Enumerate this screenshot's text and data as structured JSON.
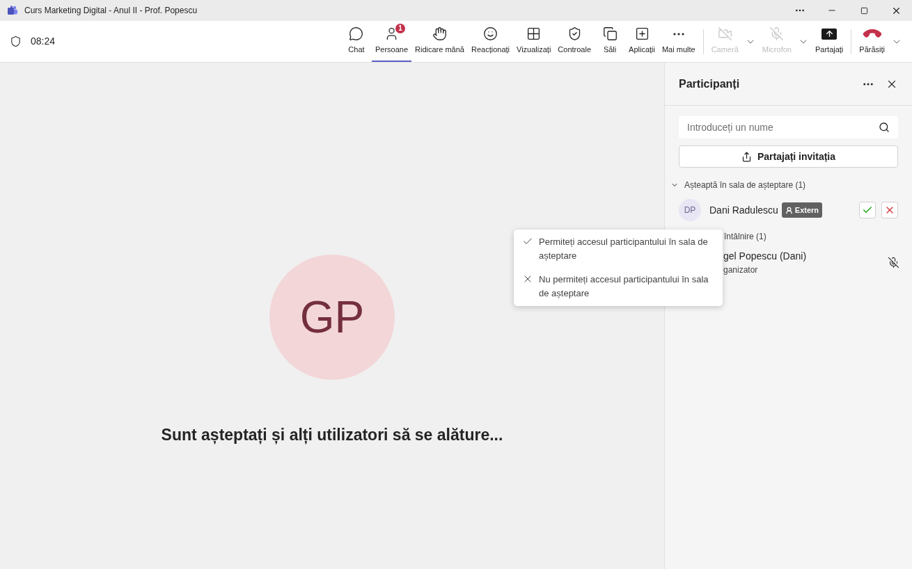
{
  "window": {
    "title": "Curs Marketing Digital - Anul II - Prof. Popescu"
  },
  "meeting": {
    "timer": "08:24"
  },
  "toolbar": [
    {
      "kind": "chat",
      "label": "Chat",
      "selected": false,
      "disabled": false
    },
    {
      "kind": "people",
      "label": "Persoane",
      "selected": true,
      "disabled": false,
      "badge": "1"
    },
    {
      "kind": "hand",
      "label": "Ridicare mână",
      "selected": false,
      "disabled": false
    },
    {
      "kind": "react",
      "label": "Reacționați",
      "selected": false,
      "disabled": false
    },
    {
      "kind": "view",
      "label": "Vizualizați",
      "selected": false,
      "disabled": false
    },
    {
      "kind": "controls",
      "label": "Controale",
      "selected": false,
      "disabled": false
    },
    {
      "kind": "rooms",
      "label": "Săli",
      "selected": false,
      "disabled": false
    },
    {
      "kind": "apps",
      "label": "Aplicații",
      "selected": false,
      "disabled": false
    },
    {
      "kind": "more",
      "label": "Mai multe",
      "selected": false,
      "disabled": false
    },
    {
      "kind": "camera",
      "label": "Cameră",
      "selected": false,
      "disabled": true,
      "caret": true
    },
    {
      "kind": "mic",
      "label": "Microfon",
      "selected": false,
      "disabled": true,
      "caret": true
    },
    {
      "kind": "share",
      "label": "Partajați",
      "selected": false,
      "disabled": false
    },
    {
      "kind": "leave",
      "label": "Părăsiți",
      "selected": false,
      "disabled": false,
      "caret": true
    }
  ],
  "stage": {
    "avatar_initials": "GP",
    "message": "Sunt așteptați și alți utilizatori să se alăture..."
  },
  "panel": {
    "title": "Participanți",
    "search": {
      "placeholder": "Introduceți un nume"
    },
    "share_button": "Partajați invitația",
    "lobby": {
      "header": "Așteaptă în sala de așteptare (1)",
      "expanded": true,
      "people": [
        {
          "initials": "DP",
          "name": "Dani Radulescu",
          "tag": "Extern"
        }
      ]
    },
    "meeting_section": {
      "header": "întâlnire (1)",
      "people": [
        {
          "name": "gel Popescu (Dani)",
          "role": "ganizator",
          "muted": true
        }
      ]
    }
  },
  "tooltip": {
    "items": [
      {
        "kind": "allow",
        "text": "Permiteți accesul participantului în sala de așteptare"
      },
      {
        "kind": "deny",
        "text": "Nu permiteți accesul participantului în sala de așteptare"
      }
    ]
  }
}
